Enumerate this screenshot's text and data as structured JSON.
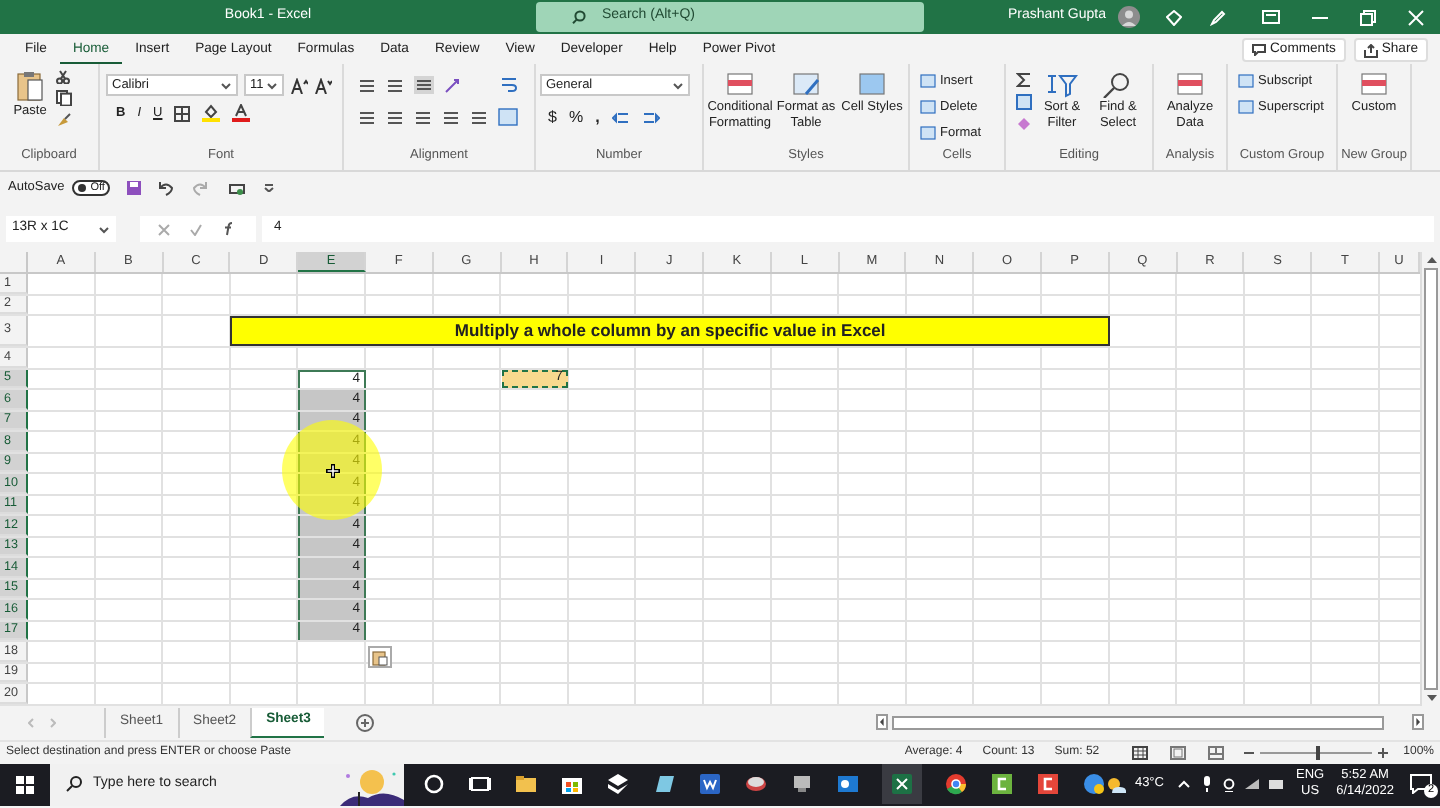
{
  "window": {
    "title": "Book1  -  Excel",
    "search_placeholder": "Search (Alt+Q)",
    "user": "Prashant Gupta"
  },
  "ribbon_tabs": [
    {
      "label": "File",
      "selected": false
    },
    {
      "label": "Home",
      "selected": true
    },
    {
      "label": "Insert",
      "selected": false
    },
    {
      "label": "Page Layout",
      "selected": false
    },
    {
      "label": "Formulas",
      "selected": false
    },
    {
      "label": "Data",
      "selected": false
    },
    {
      "label": "Review",
      "selected": false
    },
    {
      "label": "View",
      "selected": false
    },
    {
      "label": "Developer",
      "selected": false
    },
    {
      "label": "Help",
      "selected": false
    },
    {
      "label": "Power Pivot",
      "selected": false
    }
  ],
  "comments_button": "Comments",
  "share_button": "Share",
  "ribbon_groups": [
    {
      "kind": "clipboard",
      "label": "Clipboard",
      "paste": "Paste"
    },
    {
      "kind": "font",
      "label": "Font",
      "font_name": "Calibri",
      "font_size": "11",
      "bold": "B",
      "italic": "I",
      "underline": "U"
    },
    {
      "kind": "alignment",
      "label": "Alignment"
    },
    {
      "kind": "number",
      "label": "Number",
      "format": "General",
      "currency": "$",
      "percent": "%",
      "comma": ","
    },
    {
      "kind": "large",
      "label": "Styles",
      "buttons": [
        "Conditional Formatting",
        "Format as Table",
        "Cell Styles"
      ]
    },
    {
      "kind": "small",
      "label": "Cells",
      "buttons": [
        "Insert",
        "Delete",
        "Format"
      ]
    },
    {
      "kind": "editing",
      "label": "Editing",
      "buttons": [
        "Sort & Filter",
        "Find & Select"
      ]
    },
    {
      "kind": "large",
      "label": "Analysis",
      "buttons": [
        "Analyze Data"
      ]
    },
    {
      "kind": "small",
      "label": "Custom Group",
      "buttons": [
        "Subscript",
        "Superscript"
      ]
    },
    {
      "kind": "large",
      "label": "New Group",
      "buttons": [
        "Custom"
      ]
    }
  ],
  "quick_access": {
    "autosave_label": "AutoSave",
    "autosave": {
      "label": "Off",
      "on": false
    }
  },
  "formula_bar": {
    "name_box": "13R x 1C",
    "formula": "4"
  },
  "sheet": {
    "columns": [
      {
        "label": "A",
        "selected": false
      },
      {
        "label": "B",
        "selected": false
      },
      {
        "label": "C",
        "selected": false
      },
      {
        "label": "D",
        "selected": false
      },
      {
        "label": "E",
        "selected": true
      },
      {
        "label": "F",
        "selected": false
      },
      {
        "label": "G",
        "selected": false
      },
      {
        "label": "H",
        "selected": false
      },
      {
        "label": "I",
        "selected": false
      },
      {
        "label": "J",
        "selected": false
      },
      {
        "label": "K",
        "selected": false
      },
      {
        "label": "L",
        "selected": false
      },
      {
        "label": "M",
        "selected": false
      },
      {
        "label": "N",
        "selected": false
      },
      {
        "label": "O",
        "selected": false
      },
      {
        "label": "P",
        "selected": false
      },
      {
        "label": "Q",
        "selected": false
      },
      {
        "label": "R",
        "selected": false
      },
      {
        "label": "S",
        "selected": false
      },
      {
        "label": "T",
        "selected": false
      },
      {
        "label": "U",
        "selected": false
      }
    ],
    "rows": [
      {
        "label": "1",
        "selected": false
      },
      {
        "label": "2",
        "selected": false
      },
      {
        "label": "3",
        "selected": false,
        "cells": {
          "D": {
            "kind": "banner",
            "value": "Multiply a whole column by an specific value in Excel"
          }
        }
      },
      {
        "label": "4",
        "selected": false
      },
      {
        "label": "5",
        "selected": true,
        "cells": {
          "E": {
            "kind": "value",
            "value": "4",
            "active": true
          },
          "H": {
            "kind": "copied",
            "value": "7"
          }
        }
      },
      {
        "label": "6",
        "selected": true,
        "cells": {
          "E": {
            "kind": "value",
            "value": "4",
            "active": false
          }
        }
      },
      {
        "label": "7",
        "selected": true,
        "cells": {
          "E": {
            "kind": "value",
            "value": "4",
            "active": false
          }
        }
      },
      {
        "label": "8",
        "selected": true,
        "cells": {
          "E": {
            "kind": "value",
            "value": "4",
            "active": false
          }
        }
      },
      {
        "label": "9",
        "selected": true,
        "cells": {
          "E": {
            "kind": "value",
            "value": "4",
            "active": false
          }
        }
      },
      {
        "label": "10",
        "selected": true,
        "cells": {
          "E": {
            "kind": "value",
            "value": "4",
            "active": false
          }
        }
      },
      {
        "label": "11",
        "selected": true,
        "cells": {
          "E": {
            "kind": "value",
            "value": "4",
            "active": false
          }
        }
      },
      {
        "label": "12",
        "selected": true,
        "cells": {
          "E": {
            "kind": "value",
            "value": "4",
            "active": false
          }
        }
      },
      {
        "label": "13",
        "selected": true,
        "cells": {
          "E": {
            "kind": "value",
            "value": "4",
            "active": false
          }
        }
      },
      {
        "label": "14",
        "selected": true,
        "cells": {
          "E": {
            "kind": "value",
            "value": "4",
            "active": false
          }
        }
      },
      {
        "label": "15",
        "selected": true,
        "cells": {
          "E": {
            "kind": "value",
            "value": "4",
            "active": false
          }
        }
      },
      {
        "label": "16",
        "selected": true,
        "cells": {
          "E": {
            "kind": "value",
            "value": "4",
            "active": false
          }
        }
      },
      {
        "label": "17",
        "selected": true,
        "cells": {
          "E": {
            "kind": "value",
            "value": "4",
            "active": false
          }
        }
      },
      {
        "label": "18",
        "selected": false
      },
      {
        "label": "19",
        "selected": false
      },
      {
        "label": "20",
        "selected": false
      }
    ]
  },
  "sheet_tabs": [
    {
      "label": "Sheet1",
      "selected": false
    },
    {
      "label": "Sheet2",
      "selected": false
    },
    {
      "label": "Sheet3",
      "selected": true
    }
  ],
  "status_bar": {
    "message": "Select destination and press ENTER or choose Paste",
    "average": "Average: 4",
    "count": "Count: 13",
    "sum": "Sum: 52",
    "zoom": "100%",
    "zoom_slider": {
      "level": 0.53
    }
  },
  "taskbar": {
    "search_placeholder": "Type here to search",
    "weather": "43°C",
    "language": "ENG",
    "region": "US",
    "time": "5:52 AM",
    "date": "6/14/2022",
    "notifications": "2"
  }
}
